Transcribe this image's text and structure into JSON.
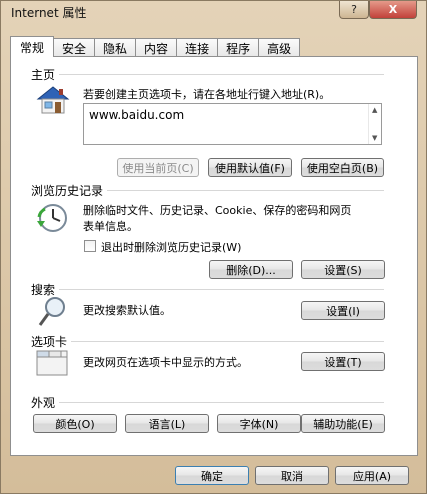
{
  "window": {
    "title": "Internet 属性",
    "help": "?",
    "close": "X"
  },
  "tabs": [
    "常规",
    "安全",
    "隐私",
    "内容",
    "连接",
    "程序",
    "高级"
  ],
  "homepage": {
    "section": "主页",
    "description": "若要创建主页选项卡，请在各地址行键入地址(R)。",
    "url": "www.baidu.com",
    "buttons": {
      "use_current": "使用当前页(C)",
      "use_default": "使用默认值(F)",
      "use_blank": "使用空白页(B)"
    }
  },
  "history": {
    "section": "浏览历史记录",
    "description_line1": "删除临时文件、历史记录、Cookie、保存的密码和网页",
    "description_line2": "表单信息。",
    "checkbox_label": "退出时删除浏览历史记录(W)",
    "buttons": {
      "delete": "删除(D)...",
      "settings": "设置(S)"
    }
  },
  "search": {
    "section": "搜索",
    "description": "更改搜索默认值。",
    "settings": "设置(I)"
  },
  "tabs_section": {
    "section": "选项卡",
    "description": "更改网页在选项卡中显示的方式。",
    "settings": "设置(T)"
  },
  "appearance": {
    "section": "外观",
    "buttons": {
      "colors": "颜色(O)",
      "languages": "语言(L)",
      "fonts": "字体(N)",
      "accessibility": "辅助功能(E)"
    }
  },
  "footer": {
    "ok": "确定",
    "cancel": "取消",
    "apply": "应用(A)"
  },
  "colors": {
    "window_frame": "#d9c5a8",
    "panel": "#ffffff",
    "close_button": "#c2413a"
  },
  "icons": [
    "home-icon",
    "history-clock-icon",
    "search-magnifier-icon",
    "tabs-window-icon"
  ]
}
